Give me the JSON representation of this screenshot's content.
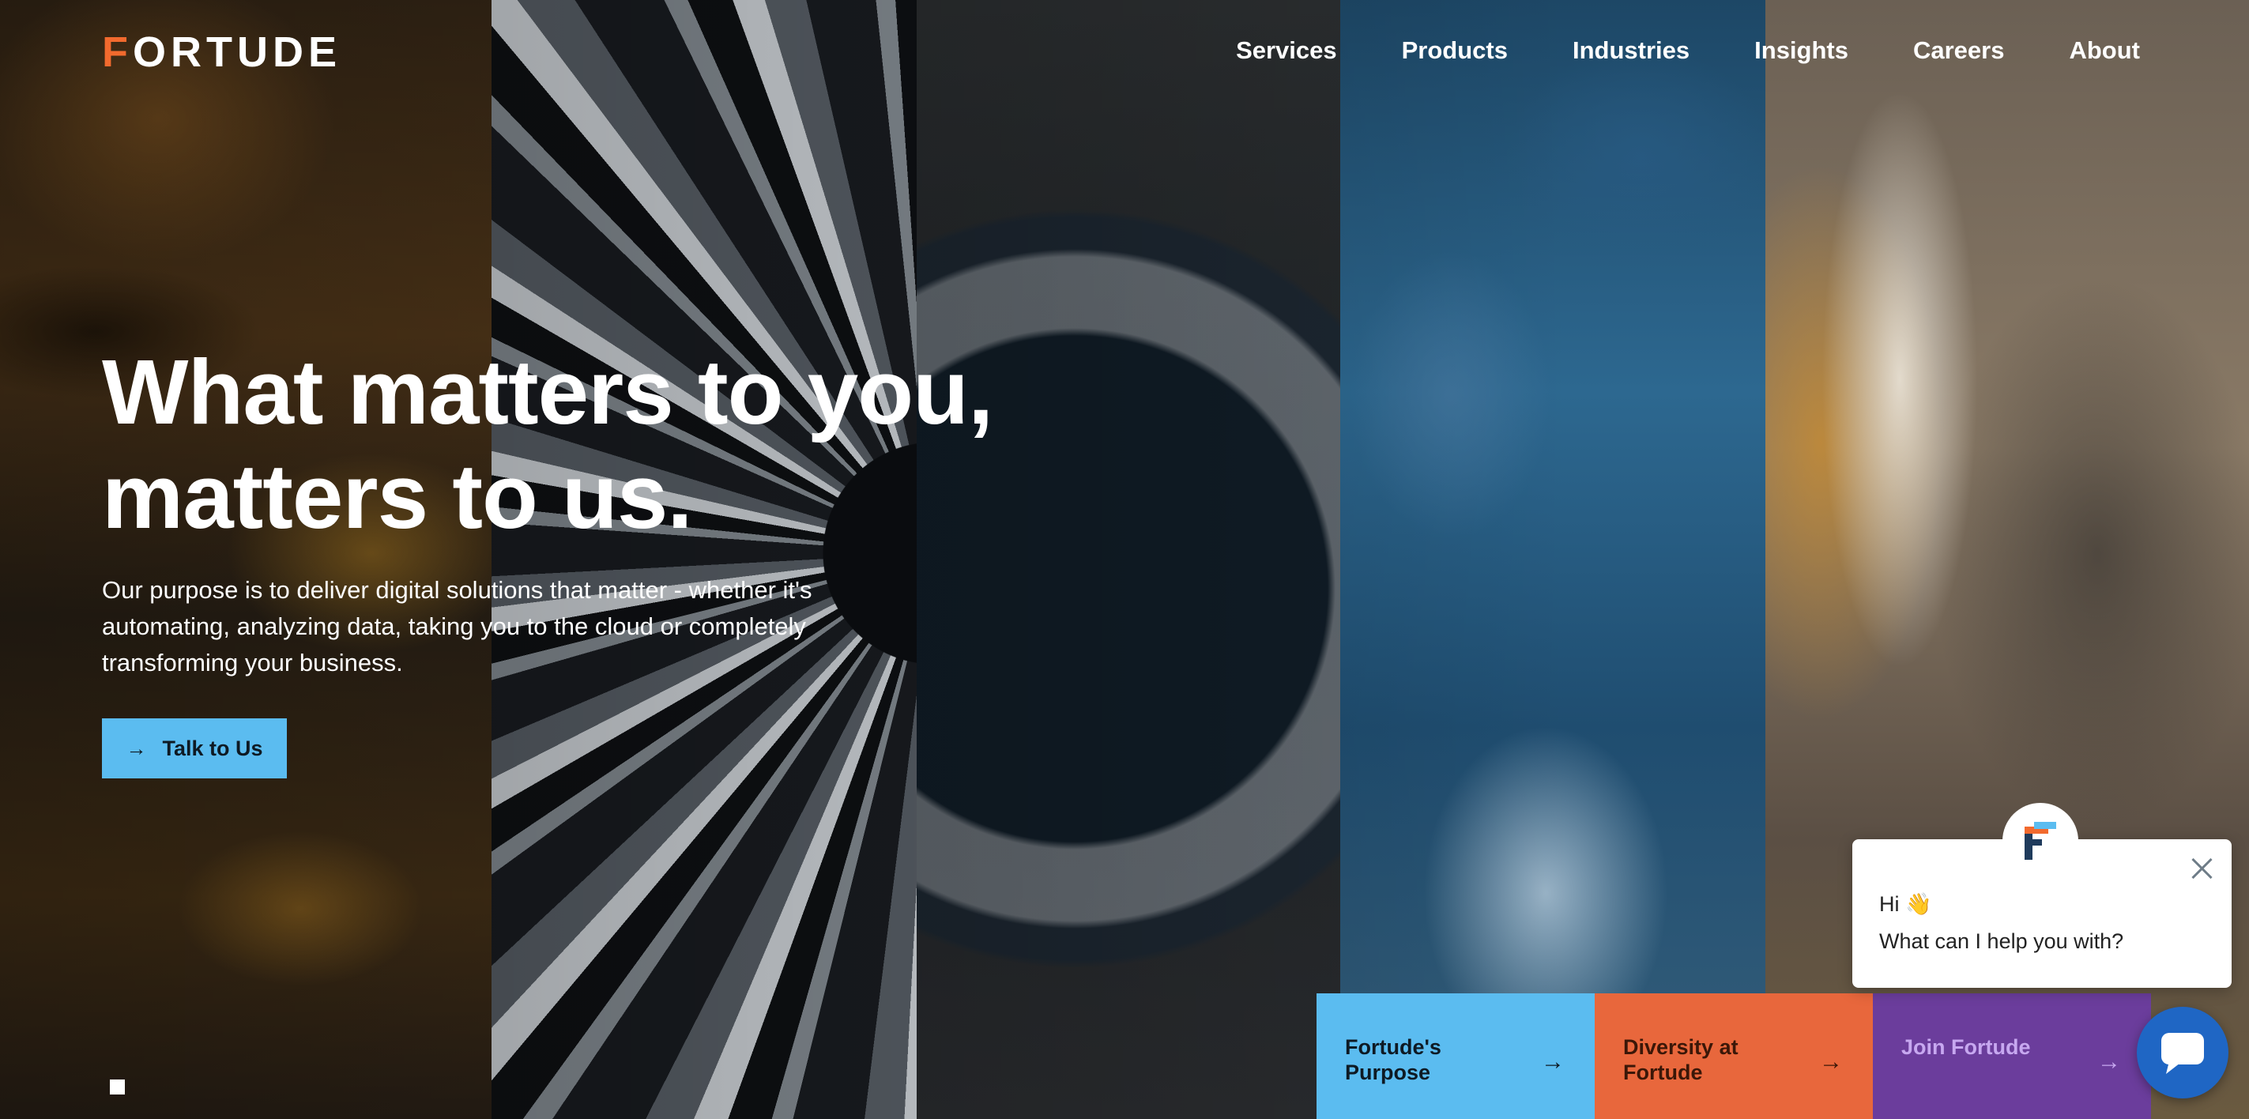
{
  "brand": {
    "logo_text": "FORTUDE",
    "accent_color": "#f26a2e"
  },
  "nav": {
    "items": [
      {
        "label": "Services"
      },
      {
        "label": "Products"
      },
      {
        "label": "Industries"
      },
      {
        "label": "Insights"
      },
      {
        "label": "Careers"
      },
      {
        "label": "About"
      }
    ]
  },
  "hero": {
    "title": "What matters to you, matters to us.",
    "description": "Our purpose is to deliver digital solutions that matter - whether it's automating, analyzing data, taking you to the cloud or completely transforming your business.",
    "cta_label": "Talk to Us",
    "cta_icon": "arrow-right-icon",
    "cta_color": "#5bbcf0"
  },
  "cards": [
    {
      "label": "Fortude's Purpose",
      "icon": "arrow-right-icon",
      "color": "#5bbcf0"
    },
    {
      "label": "Diversity at Fortude",
      "icon": "arrow-right-icon",
      "color": "#e8673c"
    },
    {
      "label": "Join Fortude",
      "icon": "arrow-right-icon",
      "color": "#6b3d9c"
    }
  ],
  "chat": {
    "greeting": "Hi 👋",
    "prompt": "What can I help you with?",
    "launcher_color": "#1f66c4"
  }
}
